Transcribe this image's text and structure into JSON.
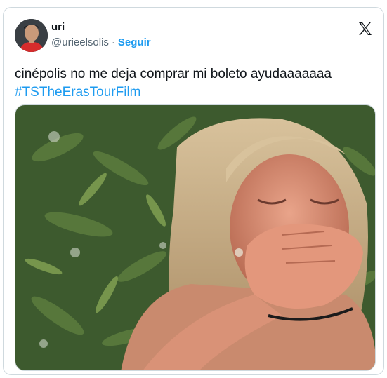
{
  "tweet": {
    "author_name": "uri",
    "handle": "@urieelsolis",
    "separator": "·",
    "follow_label": "Seguir",
    "text": "cinépolis no me deja comprar mi boleto ayudaaaaaaa",
    "hashtag": "#TSTheErasTourFilm"
  },
  "icons": {
    "platform": "x-logo-icon"
  },
  "colors": {
    "link": "#1d9bf0",
    "text": "#0f1419",
    "secondary": "#536471",
    "border": "#cfd9de"
  }
}
